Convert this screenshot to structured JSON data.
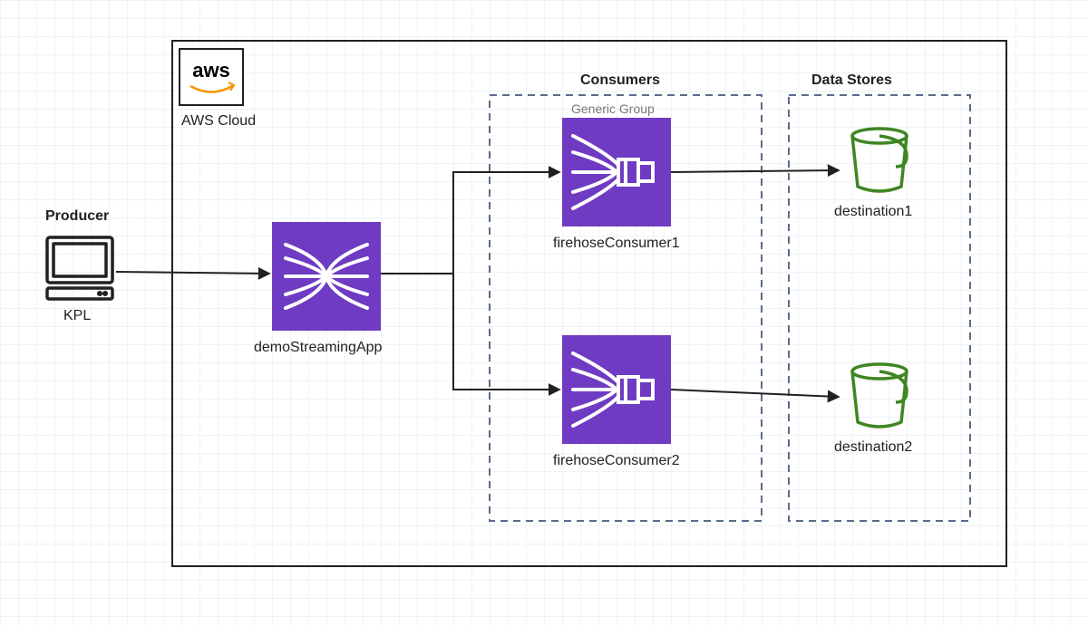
{
  "producer": {
    "heading": "Producer",
    "label": "KPL"
  },
  "cloud": {
    "badge": "aws",
    "label": "AWS Cloud"
  },
  "stream": {
    "label": "demoStreamingApp"
  },
  "consumers": {
    "heading": "Consumers",
    "group_watermark": "Generic Group",
    "items": [
      {
        "label": "firehoseConsumer1"
      },
      {
        "label": "firehoseConsumer2"
      }
    ]
  },
  "data_stores": {
    "heading": "Data Stores",
    "items": [
      {
        "label": "destination1"
      },
      {
        "label": "destination2"
      }
    ]
  },
  "colors": {
    "line": "#212121",
    "kinesis_fill": "#6f3bc2",
    "bucket": "#3f8624",
    "dash": "#5a6b8c"
  }
}
